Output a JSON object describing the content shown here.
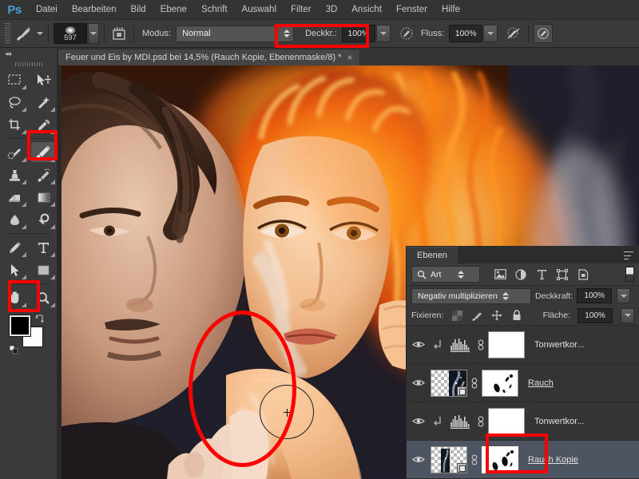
{
  "app": {
    "logo": "Ps"
  },
  "menubar": {
    "items": [
      {
        "label": "Datei"
      },
      {
        "label": "Bearbeiten"
      },
      {
        "label": "Bild"
      },
      {
        "label": "Ebene"
      },
      {
        "label": "Schrift"
      },
      {
        "label": "Auswahl"
      },
      {
        "label": "Filter"
      },
      {
        "label": "3D"
      },
      {
        "label": "Ansicht"
      },
      {
        "label": "Fenster"
      },
      {
        "label": "Hilfe"
      }
    ]
  },
  "options_bar": {
    "brush_size": "597",
    "mode_label": "Modus:",
    "mode_value": "Normal",
    "opacity_label": "Deckkr.:",
    "opacity_value": "100%",
    "flow_label": "Fluss:",
    "flow_value": "100%"
  },
  "document": {
    "tab_title": "Feuer und Eis by MDI.psd bei 14,5% (Rauch Kopie, Ebenenmaske/8) *",
    "close_glyph": "×",
    "zoom": "14,5%"
  },
  "toolbar": {
    "tools": [
      {
        "name": "rectangular-marquee"
      },
      {
        "name": "move"
      },
      {
        "name": "lasso"
      },
      {
        "name": "magic-wand"
      },
      {
        "name": "crop"
      },
      {
        "name": "eyedropper"
      },
      {
        "name": "healing-brush"
      },
      {
        "name": "brush",
        "active": true
      },
      {
        "name": "clone-stamp"
      },
      {
        "name": "history-brush"
      },
      {
        "name": "eraser"
      },
      {
        "name": "gradient"
      },
      {
        "name": "blur"
      },
      {
        "name": "dodge"
      },
      {
        "name": "pen"
      },
      {
        "name": "type"
      },
      {
        "name": "path-selection"
      },
      {
        "name": "rectangle"
      },
      {
        "name": "hand"
      },
      {
        "name": "zoom"
      }
    ],
    "foreground_color": "#000000",
    "background_color": "#ffffff"
  },
  "layers_panel": {
    "tab_label": "Ebenen",
    "kind_filter": "Art",
    "blend_mode": "Negativ multiplizieren",
    "opacity_label": "Deckkraft:",
    "opacity_value": "100%",
    "lock_label": "Fixieren:",
    "fill_label": "Fläche:",
    "fill_value": "100%",
    "layers": [
      {
        "name": "Tonwertkor...",
        "type": "adjustment",
        "visible": true,
        "clipped": true,
        "selected": false,
        "linked": true
      },
      {
        "name": "Rauch ",
        "type": "pixel",
        "visible": true,
        "clipped": false,
        "selected": false,
        "linked": true
      },
      {
        "name": "Tonwertkor...",
        "type": "adjustment",
        "visible": true,
        "clipped": true,
        "selected": false,
        "linked": true
      },
      {
        "name": "Rauch Kopie ",
        "type": "pixel",
        "visible": true,
        "clipped": false,
        "selected": true,
        "linked": true
      }
    ]
  },
  "annotations": {
    "color": "#ff0000",
    "highlights": [
      {
        "target": "opacity-field"
      },
      {
        "target": "brush-tool"
      },
      {
        "target": "color-swatch"
      },
      {
        "target": "layer-mask-thumbnail"
      },
      {
        "target": "canvas-paint-area"
      }
    ]
  },
  "canvas": {
    "description": "Feuer und Eis composite artwork"
  }
}
